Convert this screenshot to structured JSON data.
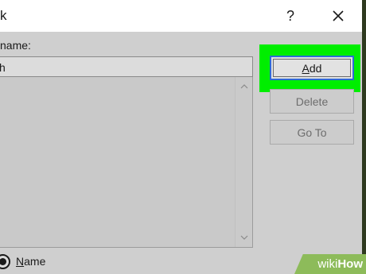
{
  "window": {
    "title_fragment": "k",
    "help_glyph": "?",
    "close_glyph": "✕"
  },
  "form": {
    "name_label": "name:",
    "name_value": "h"
  },
  "buttons": {
    "add": {
      "prefix": "",
      "accel": "A",
      "rest": "dd"
    },
    "delete": "Delete",
    "goto": "Go To"
  },
  "sort": {
    "option_accel": "N",
    "option_rest": "ame",
    "selected": true
  },
  "scrollbar": {
    "up_icon": "chevron-up-icon",
    "down_icon": "chevron-down-icon"
  },
  "watermark": {
    "wiki": "wiki",
    "how": "How"
  },
  "colors": {
    "highlight": "#00ee00",
    "focus_border": "#2f6bd5",
    "dialog_bg": "#cfcfcf",
    "watermark_bg": "#8dbb5a"
  }
}
